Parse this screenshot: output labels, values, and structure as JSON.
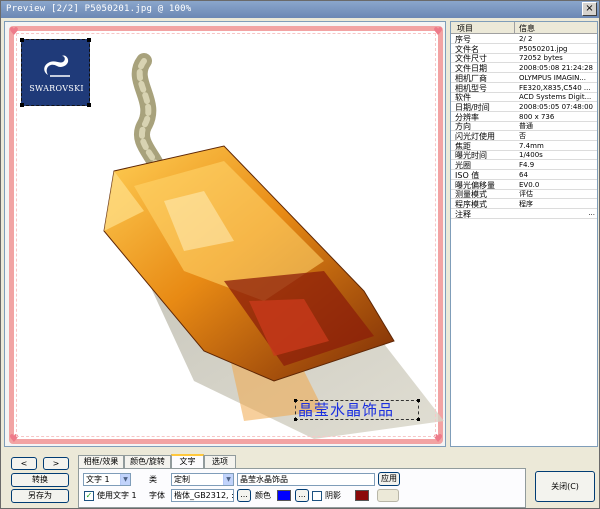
{
  "window": {
    "title": "Preview [2/2] P5050201.jpg @ 100%",
    "close_glyph": "×"
  },
  "preview": {
    "logo_text": "SWAROVSKI",
    "overlay_text": "晶莹水晶饰品",
    "frame_color": "#f2a3a3",
    "overlay_text_color": "#1a2fe0"
  },
  "properties": {
    "header": {
      "key": "项目",
      "value": "信息"
    },
    "rows": [
      {
        "key": "序号",
        "value": "2/ 2"
      },
      {
        "key": "文件名",
        "value": "P5050201.jpg"
      },
      {
        "key": "文件尺寸",
        "value": "72052 bytes"
      },
      {
        "key": "文件日期",
        "value": "2008:05:08 21:24:28"
      },
      {
        "key": "相机厂商",
        "value": "OLYMPUS IMAGIN..."
      },
      {
        "key": "相机型号",
        "value": "FE320,X835,C540 ..."
      },
      {
        "key": "软件",
        "value": "ACD Systems Digit..."
      },
      {
        "key": "日期/时间",
        "value": "2008:05:05 07:48:00"
      },
      {
        "key": "分辨率",
        "value": "800 x 736"
      },
      {
        "key": "方向",
        "value": "普通"
      },
      {
        "key": "闪光灯使用",
        "value": "否"
      },
      {
        "key": "焦距",
        "value": "7.4mm"
      },
      {
        "key": "曝光时间",
        "value": "1/400s"
      },
      {
        "key": "光圈",
        "value": "F4.9"
      },
      {
        "key": "ISO 值",
        "value": "64"
      },
      {
        "key": "曝光偏移量",
        "value": "EV0.0"
      },
      {
        "key": "测量模式",
        "value": "评估"
      },
      {
        "key": "程序模式",
        "value": "程序"
      },
      {
        "key": "注释",
        "value": ""
      }
    ],
    "more_glyph": "..."
  },
  "bottom": {
    "prev_label": "<",
    "next_label": ">",
    "convert_label": "转换",
    "save_as_label": "另存为",
    "close_label": "关闭(C)",
    "tabs": [
      "相框/效果",
      "颜色/旋转",
      "文字",
      "选项"
    ],
    "active_tab": "文字",
    "text_slot": "文字 1",
    "type_label": "类",
    "type_value": "定制",
    "text_value": "晶莹水晶饰品",
    "apply_label": "应用",
    "use_text_label": "使用文字 1",
    "use_text_checked": true,
    "font_label": "字体",
    "font_value": "楷体_GB2312, :",
    "browse_glyph": "...",
    "color_label": "颜色",
    "shadow_label": "阴影",
    "text_color": "#0000ff",
    "shadow_color": "#8b0a0a",
    "dropdown_glyph": "▼",
    "check_glyph": "✓"
  }
}
